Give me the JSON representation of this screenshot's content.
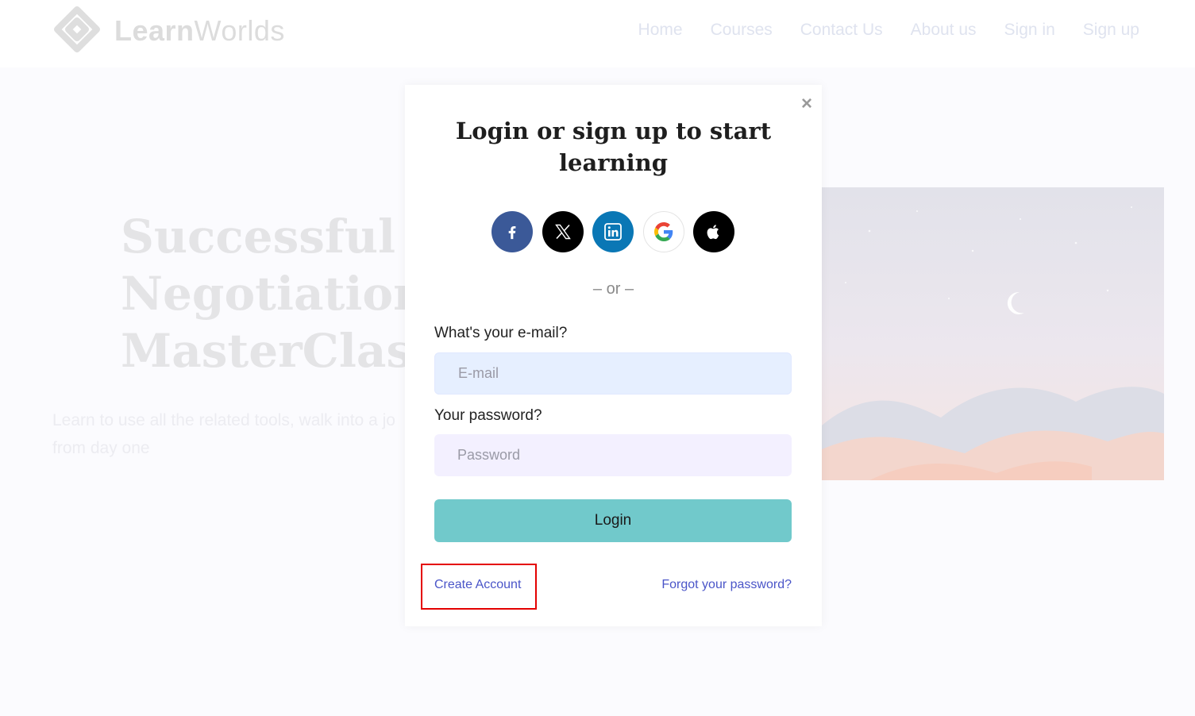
{
  "header": {
    "logo_bold": "Learn",
    "logo_light": "Worlds",
    "nav": [
      "Home",
      "Courses",
      "Contact Us",
      "About us",
      "Sign in",
      "Sign up"
    ]
  },
  "hero": {
    "title_lines": [
      "Successful",
      "Negotiation",
      "MasterClass"
    ],
    "subtitle_lines": [
      "Learn to use all the related tools, walk into a jo",
      "from day one"
    ]
  },
  "modal": {
    "close_glyph": "×",
    "title": "Login or sign up to start learning",
    "social_icons": [
      "facebook-icon",
      "x-icon",
      "linkedin-icon",
      "google-icon",
      "apple-icon"
    ],
    "or_text": "– or –",
    "email_label": "What's your e-mail?",
    "email_placeholder": "E-mail",
    "password_label": "Your password?",
    "password_placeholder": "Password",
    "login_label": "Login",
    "create_account": "Create Account",
    "forgot_password": "Forgot your password?"
  },
  "colors": {
    "accent_teal": "#71c9cb",
    "link_blue": "#4a55c8",
    "highlight_red": "#e40000",
    "facebook": "#3b5998",
    "linkedin": "#0a77b5"
  }
}
